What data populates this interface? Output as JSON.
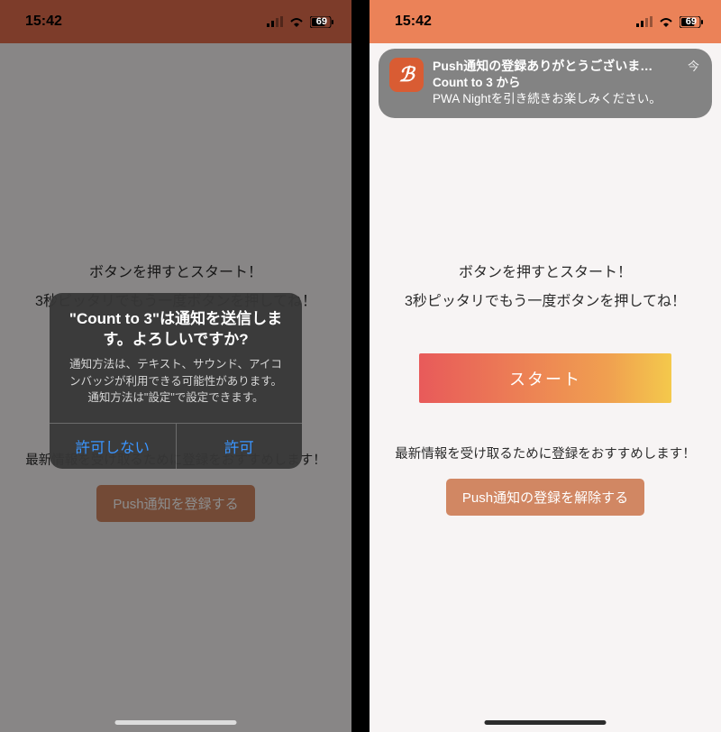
{
  "status": {
    "time": "15:42",
    "battery": "69"
  },
  "app": {
    "line1": "ボタンを押すとスタート！",
    "line2": "3秒ピッタリでもう一度ボタンを押してね！",
    "start_label": "スタート",
    "register_note": "最新情報を受け取るために登録をおすすめします！",
    "register_label_left": "Push通知を登録する",
    "register_label_right": "Push通知の登録を解除する"
  },
  "permission": {
    "title": "\"Count to 3\"は通知を送信します。よろしいですか?",
    "body": "通知方法は、テキスト、サウンド、アイコンバッジが利用できる可能性があります。通知方法は\"設定\"で設定できます。",
    "deny": "許可しない",
    "allow": "許可"
  },
  "notification": {
    "title": "Push通知の登録ありがとうございま…",
    "app_name": "Count to 3 から",
    "body": "PWA Nightを引き続きお楽しみください。",
    "time": "今",
    "icon_letter": "ℬ"
  },
  "colors": {
    "accent_orange": "#d96b4c",
    "accent_light": "#eb8258",
    "grad_start": "#e85a5a",
    "grad_end": "#f4c94c",
    "ios_blue": "#3a95ff"
  }
}
